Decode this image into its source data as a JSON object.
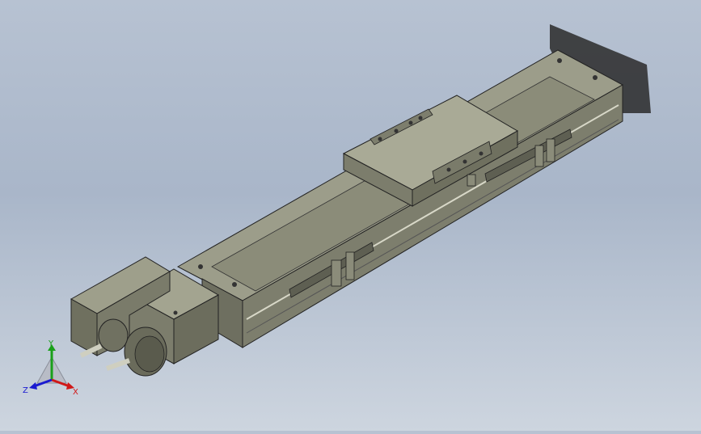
{
  "viewport": {
    "background_top": "#b7c2d2",
    "background_bottom": "#cdd5df",
    "model_color": "#8e8f7e"
  },
  "triad": {
    "x_label": "X",
    "y_label": "Y",
    "z_label": "Z",
    "x_color": "#d01818",
    "y_color": "#1aa01a",
    "z_color": "#1a1ad0"
  }
}
